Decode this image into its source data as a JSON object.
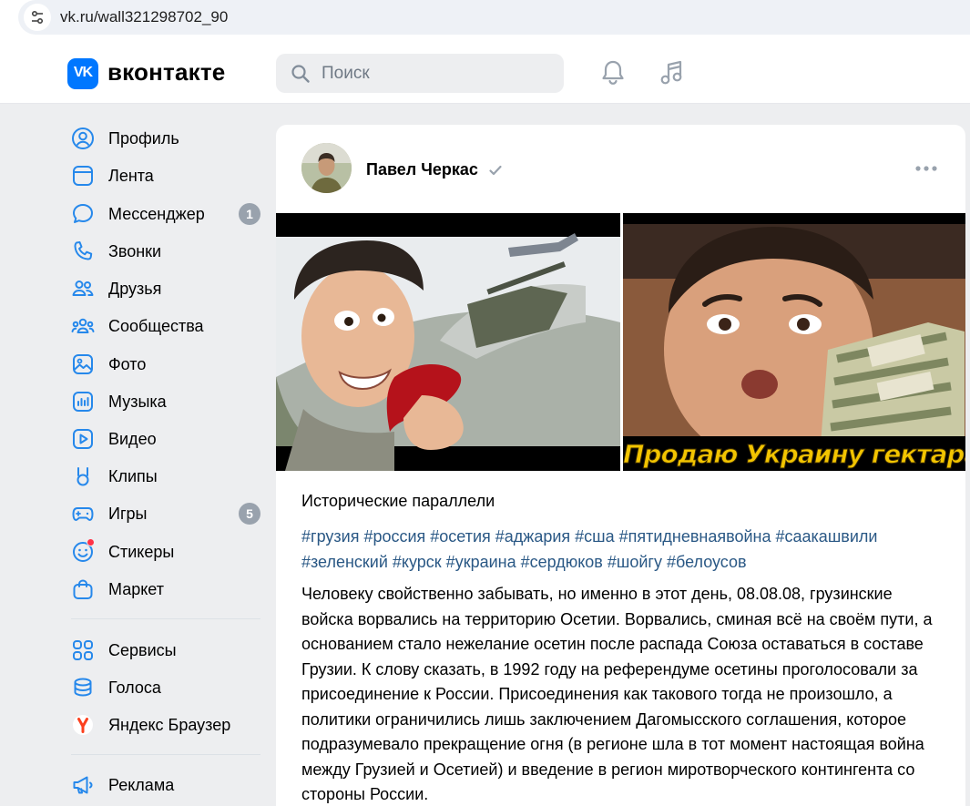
{
  "browser": {
    "url": "vk.ru/wall321298702_90"
  },
  "header": {
    "logo_mark": "VK",
    "logo_text": "вконтакте",
    "search_placeholder": "Поиск",
    "icons": [
      "search-icon",
      "bell-icon",
      "music-icon"
    ]
  },
  "sidebar": {
    "items": [
      {
        "label": "Профиль",
        "icon": "profile-icon"
      },
      {
        "label": "Лента",
        "icon": "feed-icon"
      },
      {
        "label": "Мессенджер",
        "icon": "messenger-icon",
        "badge": "1"
      },
      {
        "label": "Звонки",
        "icon": "phone-icon"
      },
      {
        "label": "Друзья",
        "icon": "friends-icon"
      },
      {
        "label": "Сообщества",
        "icon": "communities-icon"
      },
      {
        "label": "Фото",
        "icon": "photo-icon"
      },
      {
        "label": "Музыка",
        "icon": "music-icon"
      },
      {
        "label": "Видео",
        "icon": "video-icon"
      },
      {
        "label": "Клипы",
        "icon": "clips-icon"
      },
      {
        "label": "Игры",
        "icon": "games-icon",
        "badge": "5"
      },
      {
        "label": "Стикеры",
        "icon": "stickers-icon"
      },
      {
        "label": "Маркет",
        "icon": "market-icon"
      }
    ],
    "secondary": [
      {
        "label": "Сервисы",
        "icon": "services-icon"
      },
      {
        "label": "Голоса",
        "icon": "votes-icon"
      },
      {
        "label": "Яндекс Браузер",
        "icon": "yandex-browser-icon"
      }
    ],
    "tertiary": [
      {
        "label": "Реклама",
        "icon": "ads-icon"
      }
    ]
  },
  "post": {
    "author": "Павел Черкас",
    "images": [
      {
        "icon": "caricature-image"
      },
      {
        "icon": "money-photo-image",
        "caption": "Продаю Украину гектарами!.."
      }
    ],
    "title": "Исторические параллели",
    "hashtags_line1": "#грузия #россия #осетия #аджария #сша #пятидневнаявойна #саакашвили",
    "hashtags_line2": "#зеленский #курск #украина #сердюков #шойгу #белоусов",
    "text": "Человеку свойственно забывать, но именно в этот день, 08.08.08, грузинские войска ворвались на территорию Осетии. Ворвались, сминая всё на своём пути, а основанием стало нежелание осетин после распада Союза оставаться в составе Грузии. К слову сказать, в 1992 году на референдуме осетины проголосовали за присоединение к России. Присоединения как такового тогда не произошло, а политики ограничились лишь заключением Дагомысского соглашения, которое подразумевало прекращение огня (в регионе шла в тот момент настоящая война между Грузией и Осетией) и введение в регион миротворческого контингента со стороны России."
  },
  "colors": {
    "vk_blue": "#0077ff",
    "link": "#2a5885",
    "icon": "#2688eb",
    "badge": "#99a2ad",
    "background": "#edeef0"
  }
}
